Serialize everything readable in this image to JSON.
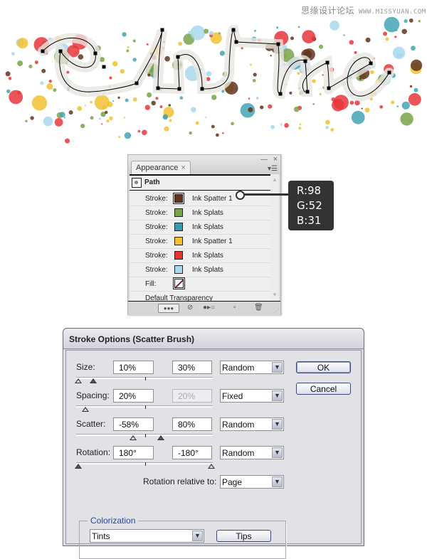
{
  "watermark": {
    "cn": "思缘设计论坛",
    "url": "WWW.MISSYUAN.COM"
  },
  "artwork": {
    "text": "Cool Time",
    "splat_colors": [
      "#e8373c",
      "#45a4b5",
      "#f2c232",
      "#7aa34a",
      "#a8d8ee",
      "#62341f"
    ]
  },
  "appearance_panel": {
    "tab_label": "Appearance",
    "tab_close": "×",
    "window_minimize": "—",
    "window_close": "×",
    "menu_icon": "▾☰",
    "header_label": "Path",
    "rows": [
      {
        "label": "Stroke:",
        "swatch": "#62341f",
        "name": "Ink Spatter 1",
        "selected": true
      },
      {
        "label": "Stroke:",
        "swatch": "#7aa34a",
        "name": "Ink Splats"
      },
      {
        "label": "Stroke:",
        "swatch": "#3a9aab",
        "name": "Ink Splats"
      },
      {
        "label": "Stroke:",
        "swatch": "#f4c12e",
        "name": "Ink Spatter 1"
      },
      {
        "label": "Stroke:",
        "swatch": "#e53232",
        "name": "Ink Splats"
      },
      {
        "label": "Stroke:",
        "swatch": "#a8d8f0",
        "name": "Ink Splats"
      }
    ],
    "fill_label": "Fill:",
    "transparency_label": "Default Transparency",
    "bottom_icons": [
      "add-effect-icon",
      "clear-appearance-icon",
      "reduce-to-basic-icon",
      "duplicate-item-icon",
      "delete-icon"
    ]
  },
  "callout": {
    "r": "R:98",
    "g": "G:52",
    "b": "B:31"
  },
  "stroke_options": {
    "title": "Stroke Options (Scatter Brush)",
    "size": {
      "label": "Size:",
      "min": "10%",
      "max": "30%",
      "mode": "Random"
    },
    "spacing": {
      "label": "Spacing:",
      "min": "20%",
      "max": "20%",
      "mode": "Fixed"
    },
    "scatter": {
      "label": "Scatter:",
      "min": "-58%",
      "max": "80%",
      "mode": "Random"
    },
    "rotation": {
      "label": "Rotation:",
      "min": "180°",
      "max": "-180°",
      "mode": "Random"
    },
    "rotation_relative_label": "Rotation relative to:",
    "rotation_relative_value": "Page",
    "colorization_label": "Colorization",
    "colorization_value": "Tints",
    "tips_label": "Tips",
    "ok_label": "OK",
    "cancel_label": "Cancel",
    "dropdown_arrow": "❯"
  }
}
